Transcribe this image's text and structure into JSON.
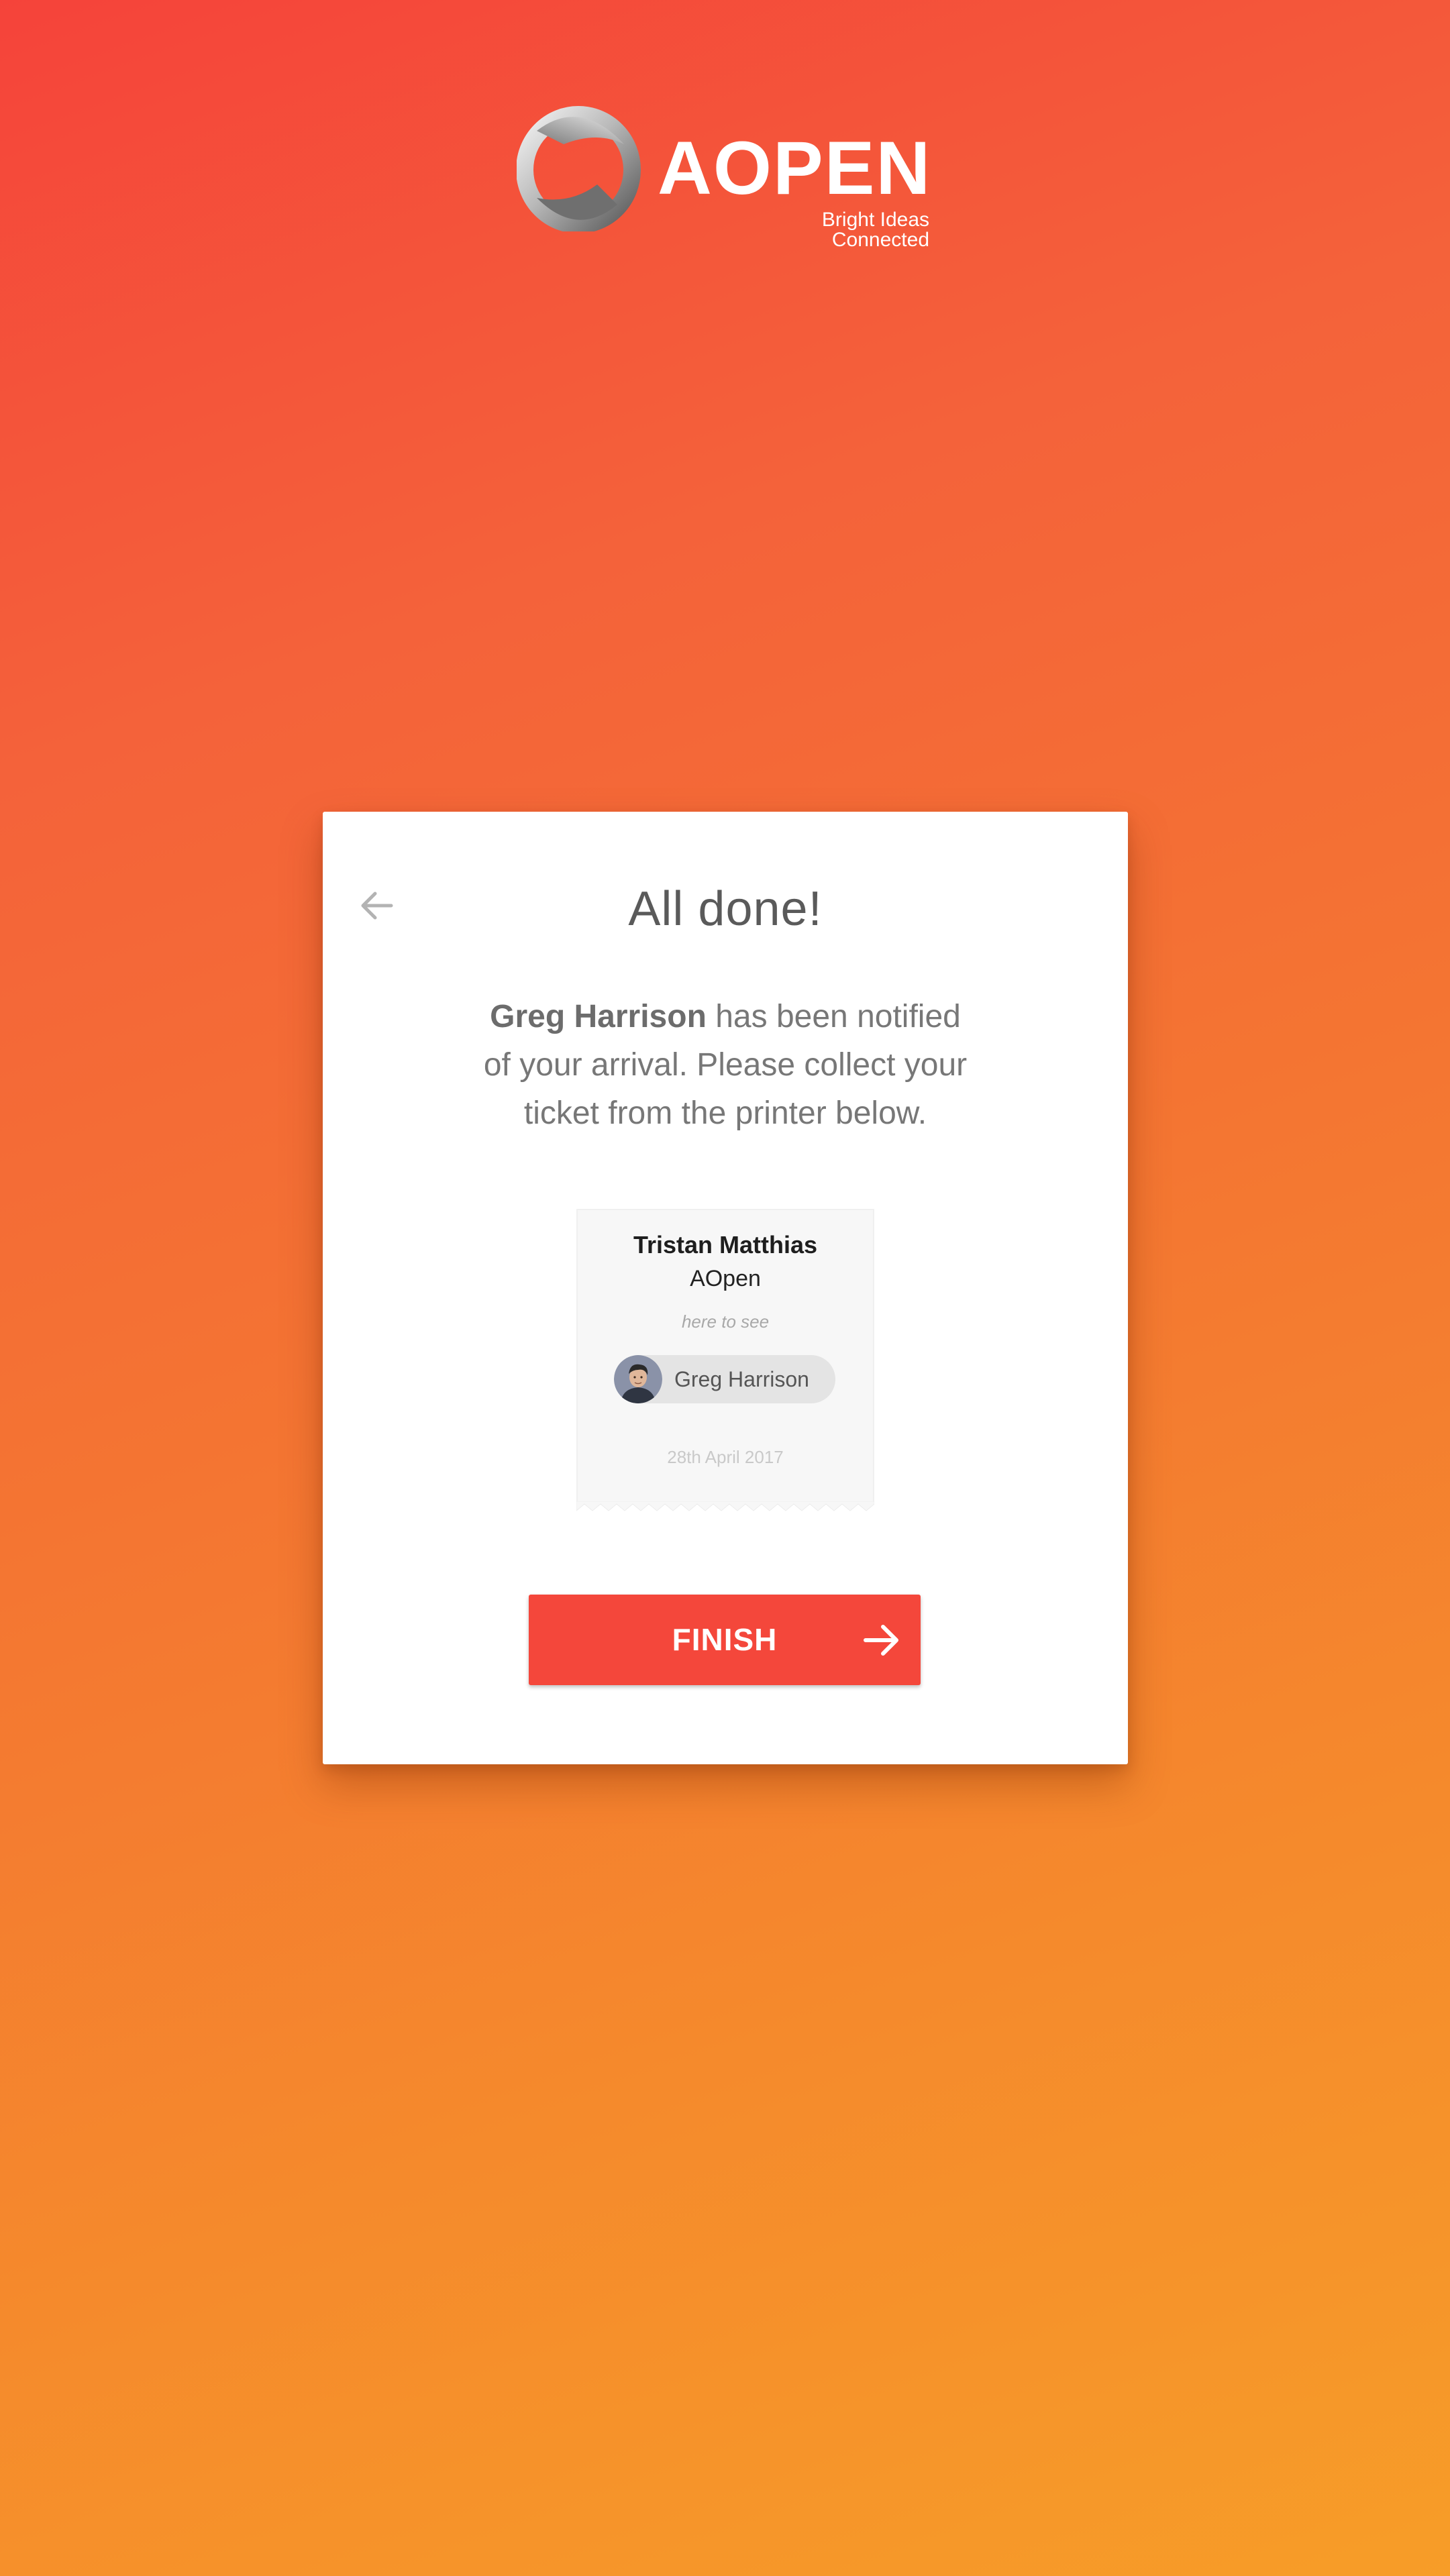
{
  "brand": {
    "name": "AOPEN",
    "tagline": "Bright Ideas Connected"
  },
  "card": {
    "title": "All done!",
    "message": {
      "host_name": "Greg Harrison",
      "text": " has been notified of your arrival. Please collect your ticket from the printer below."
    },
    "back_icon": "arrow-left-icon"
  },
  "ticket": {
    "visitor_name": "Tristan Matthias",
    "visitor_company": "AOpen",
    "here_to_see_label": "here to see",
    "host_name": "Greg Harrison",
    "date": "28th April 2017"
  },
  "finish_button": {
    "label": "FINISH",
    "icon": "arrow-right-icon"
  },
  "colors": {
    "background_start": "#f5433a",
    "background_end": "#f79d28",
    "button": "#f4473b",
    "card": "#ffffff"
  }
}
